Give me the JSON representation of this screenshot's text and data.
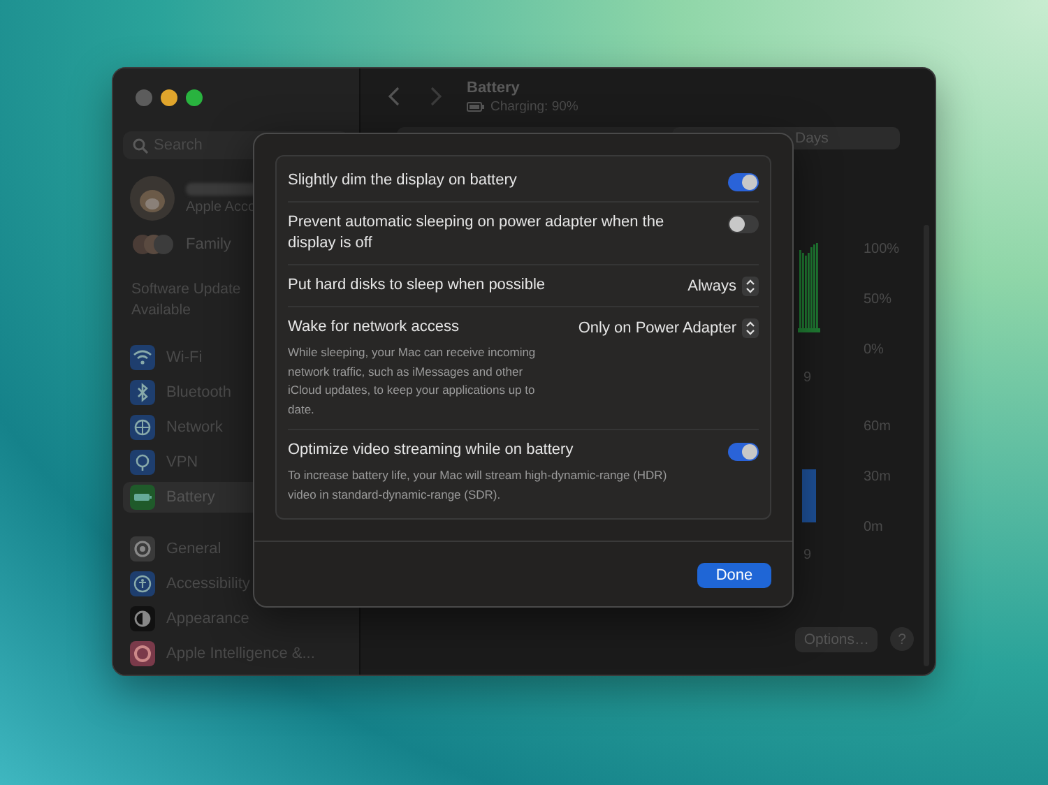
{
  "sidebar": {
    "search": {
      "placeholder": "Search"
    },
    "account": {
      "subtitle": "Apple Acco"
    },
    "family": {
      "label": "Family"
    },
    "notice": "Software Update Available",
    "groups": [
      {
        "items": [
          {
            "label": "Wi-Fi",
            "selected": false
          },
          {
            "label": "Bluetooth",
            "selected": false
          },
          {
            "label": "Network",
            "selected": false
          },
          {
            "label": "VPN",
            "selected": false
          },
          {
            "label": "Battery",
            "selected": true
          }
        ]
      },
      {
        "items": [
          {
            "label": "General",
            "selected": false
          },
          {
            "label": "Accessibility",
            "selected": false
          },
          {
            "label": "Appearance",
            "selected": false
          },
          {
            "label": "Apple Intelligence &...",
            "selected": false
          }
        ]
      }
    ]
  },
  "toolbar": {
    "title": "Battery",
    "subtitle": "Charging: 90%"
  },
  "range": {
    "label": "Days"
  },
  "level_chart": {
    "y_labels": [
      "100%",
      "50%",
      "0%"
    ],
    "x_label": "9"
  },
  "usage_chart": {
    "y_labels": [
      "60m",
      "30m",
      "0m"
    ],
    "x_label": "9"
  },
  "footer_buttons": [
    {
      "label": "Options…",
      "kind": "text"
    },
    {
      "label": "?",
      "kind": "help"
    }
  ],
  "sheet": {
    "settings": [
      {
        "kind": "toggle",
        "label": "Slightly dim the display on battery",
        "on": true
      },
      {
        "kind": "toggle",
        "label": "Prevent automatic sleeping on power adapter when the display is off",
        "on": false
      },
      {
        "kind": "popup",
        "label": "Put hard disks to sleep when possible",
        "value": "Always"
      },
      {
        "kind": "popup",
        "label": "Wake for network access",
        "value": "Only on Power Adapter",
        "description": "While sleeping, your Mac can receive incoming network traffic, such as iMessages and other iCloud updates, to keep your applications up to date."
      },
      {
        "kind": "toggle",
        "label": "Optimize video streaming while on battery",
        "on": true,
        "description": "To increase battery life, your Mac will stream high-dynamic-range (HDR) video in standard-dynamic-range (SDR)."
      }
    ],
    "button": "Done"
  }
}
